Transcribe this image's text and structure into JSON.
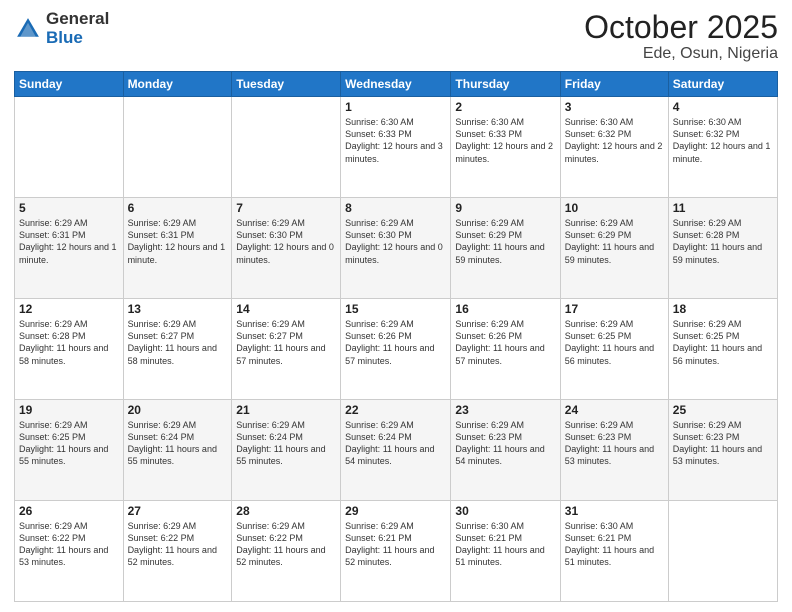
{
  "logo": {
    "general": "General",
    "blue": "Blue"
  },
  "title": "October 2025",
  "subtitle": "Ede, Osun, Nigeria",
  "weekdays": [
    "Sunday",
    "Monday",
    "Tuesday",
    "Wednesday",
    "Thursday",
    "Friday",
    "Saturday"
  ],
  "weeks": [
    [
      {
        "day": "",
        "info": ""
      },
      {
        "day": "",
        "info": ""
      },
      {
        "day": "",
        "info": ""
      },
      {
        "day": "1",
        "info": "Sunrise: 6:30 AM\nSunset: 6:33 PM\nDaylight: 12 hours and 3 minutes."
      },
      {
        "day": "2",
        "info": "Sunrise: 6:30 AM\nSunset: 6:33 PM\nDaylight: 12 hours and 2 minutes."
      },
      {
        "day": "3",
        "info": "Sunrise: 6:30 AM\nSunset: 6:32 PM\nDaylight: 12 hours and 2 minutes."
      },
      {
        "day": "4",
        "info": "Sunrise: 6:30 AM\nSunset: 6:32 PM\nDaylight: 12 hours and 1 minute."
      }
    ],
    [
      {
        "day": "5",
        "info": "Sunrise: 6:29 AM\nSunset: 6:31 PM\nDaylight: 12 hours and 1 minute."
      },
      {
        "day": "6",
        "info": "Sunrise: 6:29 AM\nSunset: 6:31 PM\nDaylight: 12 hours and 1 minute."
      },
      {
        "day": "7",
        "info": "Sunrise: 6:29 AM\nSunset: 6:30 PM\nDaylight: 12 hours and 0 minutes."
      },
      {
        "day": "8",
        "info": "Sunrise: 6:29 AM\nSunset: 6:30 PM\nDaylight: 12 hours and 0 minutes."
      },
      {
        "day": "9",
        "info": "Sunrise: 6:29 AM\nSunset: 6:29 PM\nDaylight: 11 hours and 59 minutes."
      },
      {
        "day": "10",
        "info": "Sunrise: 6:29 AM\nSunset: 6:29 PM\nDaylight: 11 hours and 59 minutes."
      },
      {
        "day": "11",
        "info": "Sunrise: 6:29 AM\nSunset: 6:28 PM\nDaylight: 11 hours and 59 minutes."
      }
    ],
    [
      {
        "day": "12",
        "info": "Sunrise: 6:29 AM\nSunset: 6:28 PM\nDaylight: 11 hours and 58 minutes."
      },
      {
        "day": "13",
        "info": "Sunrise: 6:29 AM\nSunset: 6:27 PM\nDaylight: 11 hours and 58 minutes."
      },
      {
        "day": "14",
        "info": "Sunrise: 6:29 AM\nSunset: 6:27 PM\nDaylight: 11 hours and 57 minutes."
      },
      {
        "day": "15",
        "info": "Sunrise: 6:29 AM\nSunset: 6:26 PM\nDaylight: 11 hours and 57 minutes."
      },
      {
        "day": "16",
        "info": "Sunrise: 6:29 AM\nSunset: 6:26 PM\nDaylight: 11 hours and 57 minutes."
      },
      {
        "day": "17",
        "info": "Sunrise: 6:29 AM\nSunset: 6:25 PM\nDaylight: 11 hours and 56 minutes."
      },
      {
        "day": "18",
        "info": "Sunrise: 6:29 AM\nSunset: 6:25 PM\nDaylight: 11 hours and 56 minutes."
      }
    ],
    [
      {
        "day": "19",
        "info": "Sunrise: 6:29 AM\nSunset: 6:25 PM\nDaylight: 11 hours and 55 minutes."
      },
      {
        "day": "20",
        "info": "Sunrise: 6:29 AM\nSunset: 6:24 PM\nDaylight: 11 hours and 55 minutes."
      },
      {
        "day": "21",
        "info": "Sunrise: 6:29 AM\nSunset: 6:24 PM\nDaylight: 11 hours and 55 minutes."
      },
      {
        "day": "22",
        "info": "Sunrise: 6:29 AM\nSunset: 6:24 PM\nDaylight: 11 hours and 54 minutes."
      },
      {
        "day": "23",
        "info": "Sunrise: 6:29 AM\nSunset: 6:23 PM\nDaylight: 11 hours and 54 minutes."
      },
      {
        "day": "24",
        "info": "Sunrise: 6:29 AM\nSunset: 6:23 PM\nDaylight: 11 hours and 53 minutes."
      },
      {
        "day": "25",
        "info": "Sunrise: 6:29 AM\nSunset: 6:23 PM\nDaylight: 11 hours and 53 minutes."
      }
    ],
    [
      {
        "day": "26",
        "info": "Sunrise: 6:29 AM\nSunset: 6:22 PM\nDaylight: 11 hours and 53 minutes."
      },
      {
        "day": "27",
        "info": "Sunrise: 6:29 AM\nSunset: 6:22 PM\nDaylight: 11 hours and 52 minutes."
      },
      {
        "day": "28",
        "info": "Sunrise: 6:29 AM\nSunset: 6:22 PM\nDaylight: 11 hours and 52 minutes."
      },
      {
        "day": "29",
        "info": "Sunrise: 6:29 AM\nSunset: 6:21 PM\nDaylight: 11 hours and 52 minutes."
      },
      {
        "day": "30",
        "info": "Sunrise: 6:30 AM\nSunset: 6:21 PM\nDaylight: 11 hours and 51 minutes."
      },
      {
        "day": "31",
        "info": "Sunrise: 6:30 AM\nSunset: 6:21 PM\nDaylight: 11 hours and 51 minutes."
      },
      {
        "day": "",
        "info": ""
      }
    ]
  ]
}
